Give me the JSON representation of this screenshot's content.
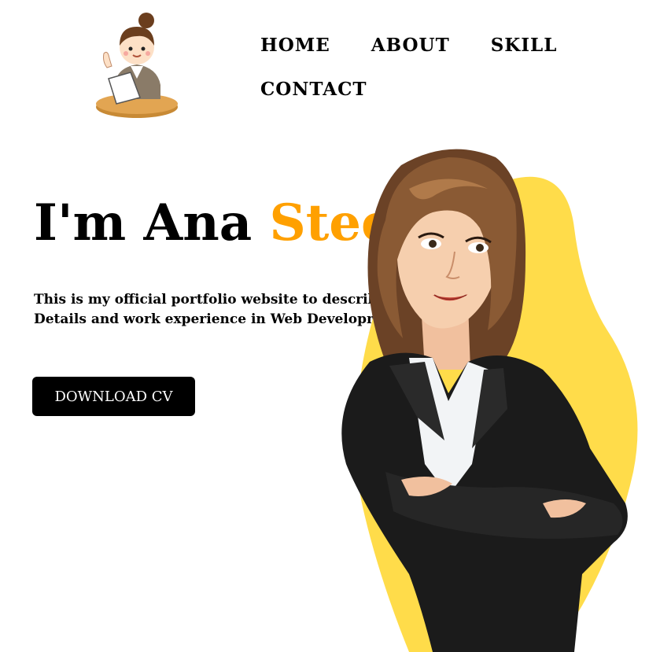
{
  "nav": {
    "home": "HOME",
    "about": "ABOUT",
    "skill": "SKILL",
    "contact": "CONTACT"
  },
  "hero": {
    "greeting": "I'm Ana ",
    "name_accent": "Steel",
    "intro": "This is my official portfolio website to describe my Details and work experience in Web Development.",
    "download_label": "DOWNLOAD CV"
  },
  "colors": {
    "accent": "#ffa000",
    "blob": "#ffdc4a",
    "button_bg": "#000000",
    "button_text": "#ffffff"
  },
  "icons": {
    "logo": "girl-at-desk-icon",
    "portrait": "businesswoman-illustration"
  }
}
